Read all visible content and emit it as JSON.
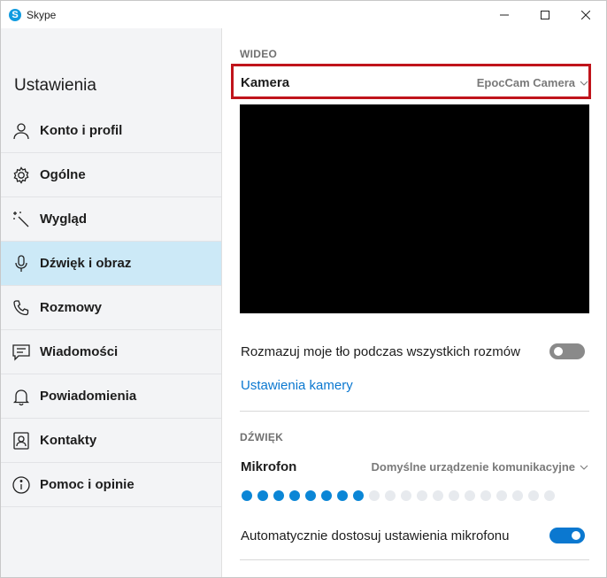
{
  "window": {
    "title": "Skype",
    "logo_letter": "S",
    "controls": {
      "minimize": "—",
      "maximize": "☐",
      "close": "✕"
    }
  },
  "sidebar": {
    "heading": "Ustawienia",
    "items": [
      {
        "label": "Konto i profil",
        "icon": "person-icon",
        "active": false
      },
      {
        "label": "Ogólne",
        "icon": "gear-icon",
        "active": false
      },
      {
        "label": "Wygląd",
        "icon": "magic-wand-icon",
        "active": false
      },
      {
        "label": "Dźwięk i obraz",
        "icon": "microphone-icon",
        "active": true
      },
      {
        "label": "Rozmowy",
        "icon": "phone-icon",
        "active": false
      },
      {
        "label": "Wiadomości",
        "icon": "message-icon",
        "active": false
      },
      {
        "label": "Powiadomienia",
        "icon": "bell-icon",
        "active": false
      },
      {
        "label": "Kontakty",
        "icon": "contact-card-icon",
        "active": false
      },
      {
        "label": "Pomoc i opinie",
        "icon": "info-icon",
        "active": false
      }
    ]
  },
  "video": {
    "section_title": "WIDEO",
    "camera_label": "Kamera",
    "camera_value": "EpocCam Camera",
    "blur_label": "Rozmazuj moje tło podczas wszystkich rozmów",
    "blur_enabled": false,
    "camera_settings_link": "Ustawienia kamery"
  },
  "audio": {
    "section_title": "DŹWIĘK",
    "mic_label": "Mikrofon",
    "mic_value": "Domyślne urządzenie komunikacyjne",
    "mic_level_active": 8,
    "mic_level_total": 20,
    "auto_adjust_label": "Automatycznie dostosuj ustawienia mikrofonu",
    "auto_adjust_enabled": true
  },
  "colors": {
    "accent": "#0b78d0",
    "highlight_box": "#c0141b",
    "active_nav": "#cce9f7"
  }
}
